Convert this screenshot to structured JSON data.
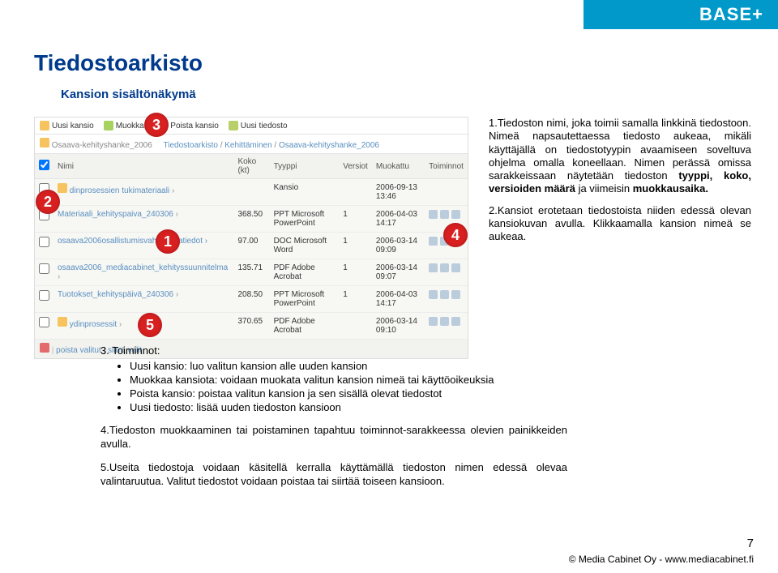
{
  "logo": "BASE+",
  "title": "Tiedostoarkisto",
  "subtitle": "Kansion sisältönäkymä",
  "toolbar": {
    "new_folder": "Uusi kansio",
    "edit": "Muokkaa",
    "delete_folder": "Poista kansio",
    "new_file": "Uusi tiedosto"
  },
  "breadcrumb": {
    "folder_label": "Osaava-kehityshanke_2006",
    "p1": "Tiedostoarkisto",
    "p2": "Kehittäminen",
    "p3": "Osaava-kehityshanke_2006"
  },
  "columns": {
    "name": "Nimi",
    "size": "Koko (kt)",
    "type": "Tyyppi",
    "versions": "Versiot",
    "modified": "Muokattu",
    "actions": "Toiminnot"
  },
  "rows": [
    {
      "folder": true,
      "name": "dinprosessien tukimateriaali",
      "size": "",
      "type": "Kansio",
      "versions": "",
      "modified": "2006-09-13 13:46"
    },
    {
      "folder": false,
      "name": "Materiaali_kehityspaiva_240306",
      "size": "368.50",
      "type": "PPT Microsoft PowerPoint",
      "versions": "1",
      "modified": "2006-04-03 14:17"
    },
    {
      "folder": false,
      "name": "osaava2006osallistumisvahv",
      "suffix": "austatiedot",
      "size": "97.00",
      "type": "DOC Microsoft Word",
      "versions": "1",
      "modified": "2006-03-14 09:09"
    },
    {
      "folder": false,
      "name": "osaava2006_mediacabinet_kehityssuunnitelma",
      "size": "135.71",
      "type": "PDF Adobe Acrobat",
      "versions": "1",
      "modified": "2006-03-14 09:07"
    },
    {
      "folder": false,
      "name": "Tuotokset_kehityspäivä_240306",
      "size": "208.50",
      "type": "PPT Microsoft PowerPoint",
      "versions": "1",
      "modified": "2006-04-03 14:17"
    },
    {
      "folder": true,
      "name": "ydinprosessit",
      "size": "370.65",
      "type": "PDF Adobe Acrobat",
      "versions": "",
      "modified": "2006-03-14 09:10"
    }
  ],
  "footer_actions": {
    "delete_selected": "poista valitut",
    "move_selected": "siirrä valit"
  },
  "markers": {
    "m1": "1",
    "m2": "2",
    "m3": "3",
    "m4": "4",
    "m5": "5"
  },
  "side": {
    "p1a": "1.Tiedoston nimi, joka toimii samalla linkkinä tiedostoon. Nimeä napsautettaessa tiedosto aukeaa, mikäli käyttäjällä on tiedostotyypin avaamiseen soveltuva ohjelma omalla koneellaan. Nimen perässä omissa sarakkeissaan näytetään tiedoston ",
    "p1b": "tyyppi, koko, versioiden määrä",
    "p1c": " ja viimeisin ",
    "p1d": "muokkausaika.",
    "p2": "2.Kansiot erotetaan tiedostoista niiden edessä olevan kansiokuvan avulla. Klikkaamalla kansion nimeä se aukeaa."
  },
  "below": {
    "l3": "3. Toiminnot:",
    "b1": "Uusi kansio: luo valitun kansion alle uuden kansion",
    "b2": "Muokkaa kansiota: voidaan muokata valitun kansion nimeä tai käyttöoikeuksia",
    "b3": "Poista kansio: poistaa valitun kansion ja sen sisällä olevat tiedostot",
    "b4": "Uusi tiedosto: lisää uuden tiedoston kansioon",
    "l4": "4.Tiedoston muokkaaminen tai poistaminen tapahtuu toiminnot-sarakkeessa olevien painikkeiden avulla.",
    "l5": "5.Useita tiedostoja voidaan käsitellä kerralla käyttämällä tiedoston nimen edessä olevaa valintaruutua. Valitut tiedostot voidaan poistaa tai siirtää toiseen kansioon."
  },
  "pagenum": "7",
  "footer": "© Media Cabinet Oy - www.mediacabinet.fi"
}
